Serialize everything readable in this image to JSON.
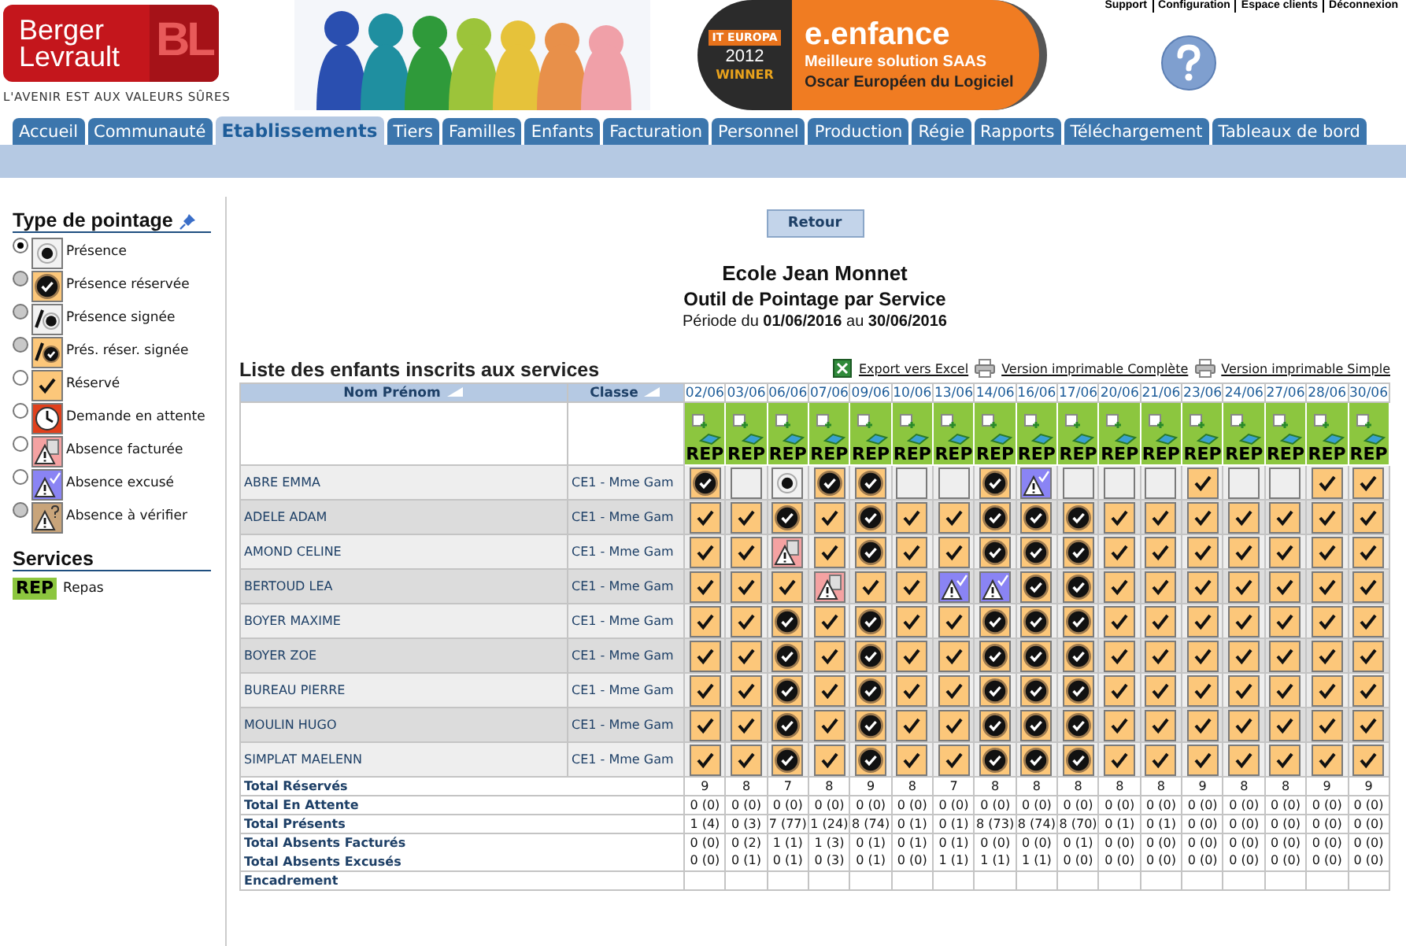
{
  "top_links": [
    "Support",
    "Configuration",
    "Espace clients",
    "Déconnexion"
  ],
  "logo": {
    "line1": "Berger",
    "line2": "Levrault",
    "mark": "BL",
    "tagline": "L'AVENIR EST AUX VALEURS SÛRES"
  },
  "award": {
    "badge": "IT EUROPA",
    "year": "2012",
    "label": "WINNER",
    "product": "e.enfance",
    "line1": "Meilleure solution SAAS",
    "line2": "Oscar Européen du Logiciel"
  },
  "tabs": [
    {
      "label": "Accueil",
      "selected": false
    },
    {
      "label": "Communauté",
      "selected": false
    },
    {
      "label": "Etablissements",
      "selected": true
    },
    {
      "label": "Tiers",
      "selected": false
    },
    {
      "label": "Familles",
      "selected": false
    },
    {
      "label": "Enfants",
      "selected": false
    },
    {
      "label": "Facturation",
      "selected": false
    },
    {
      "label": "Personnel",
      "selected": false
    },
    {
      "label": "Production",
      "selected": false
    },
    {
      "label": "Régie",
      "selected": false
    },
    {
      "label": "Rapports",
      "selected": false
    },
    {
      "label": "Téléchargement",
      "selected": false
    },
    {
      "label": "Tableaux de bord",
      "selected": false
    }
  ],
  "legend": {
    "title": "Type de pointage",
    "items": [
      {
        "kind": "presence",
        "label": "Présence",
        "selected": true,
        "disabled": false
      },
      {
        "kind": "presence_reservee",
        "label": "Présence réservée",
        "selected": false,
        "disabled": true
      },
      {
        "kind": "presence_signee",
        "label": "Présence signée",
        "selected": false,
        "disabled": true
      },
      {
        "kind": "pres_reser_signee",
        "label": "Prés. réser. signée",
        "selected": false,
        "disabled": true
      },
      {
        "kind": "reserve",
        "label": "Réservé",
        "selected": false,
        "disabled": false
      },
      {
        "kind": "attente",
        "label": "Demande en attente",
        "selected": false,
        "disabled": false
      },
      {
        "kind": "absence_facturee",
        "label": "Absence facturée",
        "selected": false,
        "disabled": false
      },
      {
        "kind": "absence_excuse",
        "label": "Absence excusé",
        "selected": false,
        "disabled": false
      },
      {
        "kind": "absence_verifier",
        "label": "Absence à vérifier",
        "selected": false,
        "disabled": true
      }
    ]
  },
  "services": {
    "title": "Services",
    "items": [
      {
        "code": "REP",
        "label": "Repas"
      }
    ]
  },
  "back_button": "Retour",
  "school": "Ecole Jean Monnet",
  "tool_title": "Outil de Pointage par Service",
  "period": "Période du **01/06/2016** au **30/06/2016**",
  "list_title": "Liste des enfants inscrits aux services",
  "actions": [
    {
      "kind": "excel",
      "label": "Export vers Excel"
    },
    {
      "kind": "print",
      "label": "Version imprimable Complète"
    },
    {
      "kind": "print",
      "label": "Version imprimable Simple"
    }
  ],
  "table": {
    "columns": [
      "Nom Prénom",
      "Classe"
    ],
    "dates": [
      {
        "date": "02/06",
        "service": "REP"
      },
      {
        "date": "03/06",
        "service": "REP"
      },
      {
        "date": "06/06",
        "service": "REP"
      },
      {
        "date": "07/06",
        "service": "REP"
      },
      {
        "date": "09/06",
        "service": "REP"
      },
      {
        "date": "10/06",
        "service": "REP"
      },
      {
        "date": "13/06",
        "service": "REP"
      },
      {
        "date": "14/06",
        "service": "REP"
      },
      {
        "date": "16/06",
        "service": "REP"
      },
      {
        "date": "17/06",
        "service": "REP"
      },
      {
        "date": "20/06",
        "service": "REP"
      },
      {
        "date": "21/06",
        "service": "REP"
      },
      {
        "date": "23/06",
        "service": "REP"
      },
      {
        "date": "24/06",
        "service": "REP"
      },
      {
        "date": "27/06",
        "service": "REP"
      },
      {
        "date": "28/06",
        "service": "REP"
      },
      {
        "date": "30/06",
        "service": "REP"
      }
    ],
    "rows": [
      {
        "name": "ABRE EMMA",
        "class": "CE1 - Mme Gam",
        "cells": [
          {
            "kind": "presence_reservee"
          },
          {
            "kind": "empty"
          },
          {
            "kind": "presence"
          },
          {
            "kind": "presence_reservee"
          },
          {
            "kind": "presence_reservee"
          },
          {
            "kind": "empty"
          },
          {
            "kind": "empty"
          },
          {
            "kind": "presence_reservee"
          },
          {
            "kind": "absence_excuse"
          },
          {
            "kind": "empty"
          },
          {
            "kind": "empty"
          },
          {
            "kind": "empty"
          },
          {
            "kind": "reserve"
          },
          {
            "kind": "empty"
          },
          {
            "kind": "empty"
          },
          {
            "kind": "reserve"
          },
          {
            "kind": "reserve"
          }
        ]
      },
      {
        "name": "ADELE ADAM",
        "class": "CE1 - Mme Gam",
        "cells": [
          {
            "kind": "reserve"
          },
          {
            "kind": "reserve"
          },
          {
            "kind": "presence_reservee"
          },
          {
            "kind": "reserve"
          },
          {
            "kind": "presence_reservee"
          },
          {
            "kind": "reserve"
          },
          {
            "kind": "reserve"
          },
          {
            "kind": "presence_reservee"
          },
          {
            "kind": "presence_reservee"
          },
          {
            "kind": "presence_reservee"
          },
          {
            "kind": "reserve"
          },
          {
            "kind": "reserve"
          },
          {
            "kind": "reserve"
          },
          {
            "kind": "reserve"
          },
          {
            "kind": "reserve"
          },
          {
            "kind": "reserve"
          },
          {
            "kind": "reserve"
          }
        ]
      },
      {
        "name": "AMOND CELINE",
        "class": "CE1 - Mme Gam",
        "cells": [
          {
            "kind": "reserve"
          },
          {
            "kind": "reserve"
          },
          {
            "kind": "absence_facturee"
          },
          {
            "kind": "reserve"
          },
          {
            "kind": "presence_reservee"
          },
          {
            "kind": "reserve"
          },
          {
            "kind": "reserve"
          },
          {
            "kind": "presence_reservee"
          },
          {
            "kind": "presence_reservee"
          },
          {
            "kind": "presence_reservee"
          },
          {
            "kind": "reserve"
          },
          {
            "kind": "reserve"
          },
          {
            "kind": "reserve"
          },
          {
            "kind": "reserve"
          },
          {
            "kind": "reserve"
          },
          {
            "kind": "reserve"
          },
          {
            "kind": "reserve"
          }
        ]
      },
      {
        "name": "BERTOUD LEA",
        "class": "CE1 - Mme Gam",
        "cells": [
          {
            "kind": "reserve"
          },
          {
            "kind": "reserve"
          },
          {
            "kind": "reserve"
          },
          {
            "kind": "absence_facturee"
          },
          {
            "kind": "reserve"
          },
          {
            "kind": "reserve"
          },
          {
            "kind": "absence_excuse"
          },
          {
            "kind": "absence_excuse"
          },
          {
            "kind": "presence_reservee"
          },
          {
            "kind": "presence_reservee"
          },
          {
            "kind": "reserve"
          },
          {
            "kind": "reserve"
          },
          {
            "kind": "reserve"
          },
          {
            "kind": "reserve"
          },
          {
            "kind": "reserve"
          },
          {
            "kind": "reserve"
          },
          {
            "kind": "reserve"
          }
        ]
      },
      {
        "name": "BOYER MAXIME",
        "class": "CE1 - Mme Gam",
        "cells": [
          {
            "kind": "reserve"
          },
          {
            "kind": "reserve"
          },
          {
            "kind": "presence_reservee"
          },
          {
            "kind": "reserve"
          },
          {
            "kind": "presence_reservee"
          },
          {
            "kind": "reserve"
          },
          {
            "kind": "reserve"
          },
          {
            "kind": "presence_reservee"
          },
          {
            "kind": "presence_reservee"
          },
          {
            "kind": "presence_reservee"
          },
          {
            "kind": "reserve"
          },
          {
            "kind": "reserve"
          },
          {
            "kind": "reserve"
          },
          {
            "kind": "reserve"
          },
          {
            "kind": "reserve"
          },
          {
            "kind": "reserve"
          },
          {
            "kind": "reserve"
          }
        ]
      },
      {
        "name": "BOYER ZOE",
        "class": "CE1 - Mme Gam",
        "cells": [
          {
            "kind": "reserve"
          },
          {
            "kind": "reserve"
          },
          {
            "kind": "presence_reservee"
          },
          {
            "kind": "reserve"
          },
          {
            "kind": "presence_reservee"
          },
          {
            "kind": "reserve"
          },
          {
            "kind": "reserve"
          },
          {
            "kind": "presence_reservee"
          },
          {
            "kind": "presence_reservee"
          },
          {
            "kind": "presence_reservee"
          },
          {
            "kind": "reserve"
          },
          {
            "kind": "reserve"
          },
          {
            "kind": "reserve"
          },
          {
            "kind": "reserve"
          },
          {
            "kind": "reserve"
          },
          {
            "kind": "reserve"
          },
          {
            "kind": "reserve"
          }
        ]
      },
      {
        "name": "BUREAU PIERRE",
        "class": "CE1 - Mme Gam",
        "cells": [
          {
            "kind": "reserve"
          },
          {
            "kind": "reserve"
          },
          {
            "kind": "presence_reservee"
          },
          {
            "kind": "reserve"
          },
          {
            "kind": "presence_reservee"
          },
          {
            "kind": "reserve"
          },
          {
            "kind": "reserve"
          },
          {
            "kind": "presence_reservee"
          },
          {
            "kind": "presence_reservee"
          },
          {
            "kind": "presence_reservee"
          },
          {
            "kind": "reserve"
          },
          {
            "kind": "reserve"
          },
          {
            "kind": "reserve"
          },
          {
            "kind": "reserve"
          },
          {
            "kind": "reserve"
          },
          {
            "kind": "reserve"
          },
          {
            "kind": "reserve"
          }
        ]
      },
      {
        "name": "MOULIN HUGO",
        "class": "CE1 - Mme Gam",
        "cells": [
          {
            "kind": "reserve"
          },
          {
            "kind": "reserve"
          },
          {
            "kind": "presence_reservee"
          },
          {
            "kind": "reserve"
          },
          {
            "kind": "presence_reservee"
          },
          {
            "kind": "reserve"
          },
          {
            "kind": "reserve"
          },
          {
            "kind": "presence_reservee"
          },
          {
            "kind": "presence_reservee"
          },
          {
            "kind": "presence_reservee"
          },
          {
            "kind": "reserve"
          },
          {
            "kind": "reserve"
          },
          {
            "kind": "reserve"
          },
          {
            "kind": "reserve"
          },
          {
            "kind": "reserve"
          },
          {
            "kind": "reserve"
          },
          {
            "kind": "reserve"
          }
        ]
      },
      {
        "name": "SIMPLAT MAELENN",
        "class": "CE1 - Mme Gam",
        "cells": [
          {
            "kind": "reserve"
          },
          {
            "kind": "reserve"
          },
          {
            "kind": "presence_reservee"
          },
          {
            "kind": "reserve"
          },
          {
            "kind": "presence_reservee"
          },
          {
            "kind": "reserve"
          },
          {
            "kind": "reserve"
          },
          {
            "kind": "presence_reservee"
          },
          {
            "kind": "presence_reservee"
          },
          {
            "kind": "presence_reservee"
          },
          {
            "kind": "reserve"
          },
          {
            "kind": "reserve"
          },
          {
            "kind": "reserve"
          },
          {
            "kind": "reserve"
          },
          {
            "kind": "reserve"
          },
          {
            "kind": "reserve"
          },
          {
            "kind": "reserve"
          }
        ]
      }
    ],
    "totals": [
      {
        "label": "Total Réservés",
        "values": [
          "9",
          "8",
          "7",
          "8",
          "9",
          "8",
          "7",
          "8",
          "8",
          "8",
          "8",
          "8",
          "9",
          "8",
          "8",
          "9",
          "9"
        ]
      },
      {
        "label": "Total En Attente",
        "values": [
          "0 (0)",
          "0 (0)",
          "0 (0)",
          "0 (0)",
          "0 (0)",
          "0 (0)",
          "0 (0)",
          "0 (0)",
          "0 (0)",
          "0 (0)",
          "0 (0)",
          "0 (0)",
          "0 (0)",
          "0 (0)",
          "0 (0)",
          "0 (0)",
          "0 (0)"
        ]
      },
      {
        "label": "Total Présents",
        "values": [
          "1 (4)",
          "0 (3)",
          "7 (77)",
          "1 (24)",
          "8 (74)",
          "0 (1)",
          "0 (1)",
          "8 (73)",
          "8 (74)",
          "8 (70)",
          "0 (1)",
          "0 (1)",
          "0 (0)",
          "0 (0)",
          "0 (0)",
          "0 (0)",
          "0 (0)"
        ]
      },
      {
        "label": "Total Absents Facturés",
        "values": [
          "0 (0)",
          "0 (2)",
          "1 (1)",
          "1 (3)",
          "0 (1)",
          "0 (1)",
          "0 (1)",
          "0 (0)",
          "0 (0)",
          "0 (1)",
          "0 (0)",
          "0 (0)",
          "0 (0)",
          "0 (0)",
          "0 (0)",
          "0 (0)",
          "0 (0)"
        ]
      },
      {
        "label": "Total Absents Excusés",
        "values": [
          "0 (0)",
          "0 (1)",
          "0 (1)",
          "0 (3)",
          "0 (1)",
          "0 (0)",
          "1 (1)",
          "1 (1)",
          "1 (1)",
          "0 (0)",
          "0 (0)",
          "0 (0)",
          "0 (0)",
          "0 (0)",
          "0 (0)",
          "0 (0)",
          "0 (0)"
        ]
      },
      {
        "label": "Encadrement"
      }
    ]
  }
}
